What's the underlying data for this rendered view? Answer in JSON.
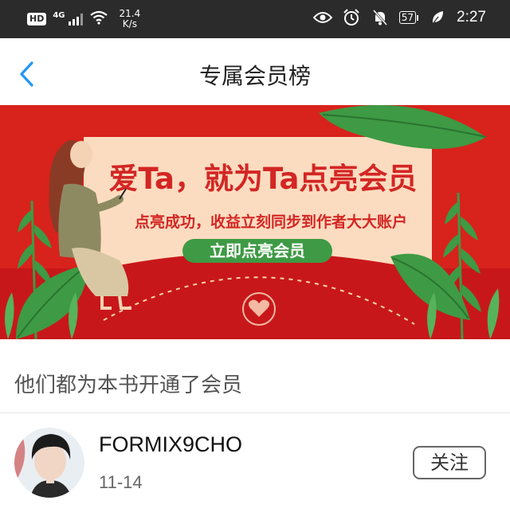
{
  "status_bar": {
    "hd": "HD",
    "network": "4G",
    "speed_value": "21.4",
    "speed_unit": "K/s",
    "battery": "57",
    "time": "2:27"
  },
  "header": {
    "title": "专属会员榜"
  },
  "banner": {
    "title": "爱Ta，就为Ta点亮会员",
    "subtitle": "点亮成功，收益立刻同步到作者大大账户",
    "button_label": "立即点亮会员"
  },
  "section": {
    "title": "他们都为本书开通了会员"
  },
  "members": [
    {
      "name": "FORMIX9CHO",
      "date": "11-14",
      "follow_label": "关注"
    }
  ],
  "colors": {
    "banner_red": "#d8221c",
    "banner_cream": "#fcdcc0",
    "button_green": "#3e9a44",
    "back_blue": "#2196f3"
  }
}
